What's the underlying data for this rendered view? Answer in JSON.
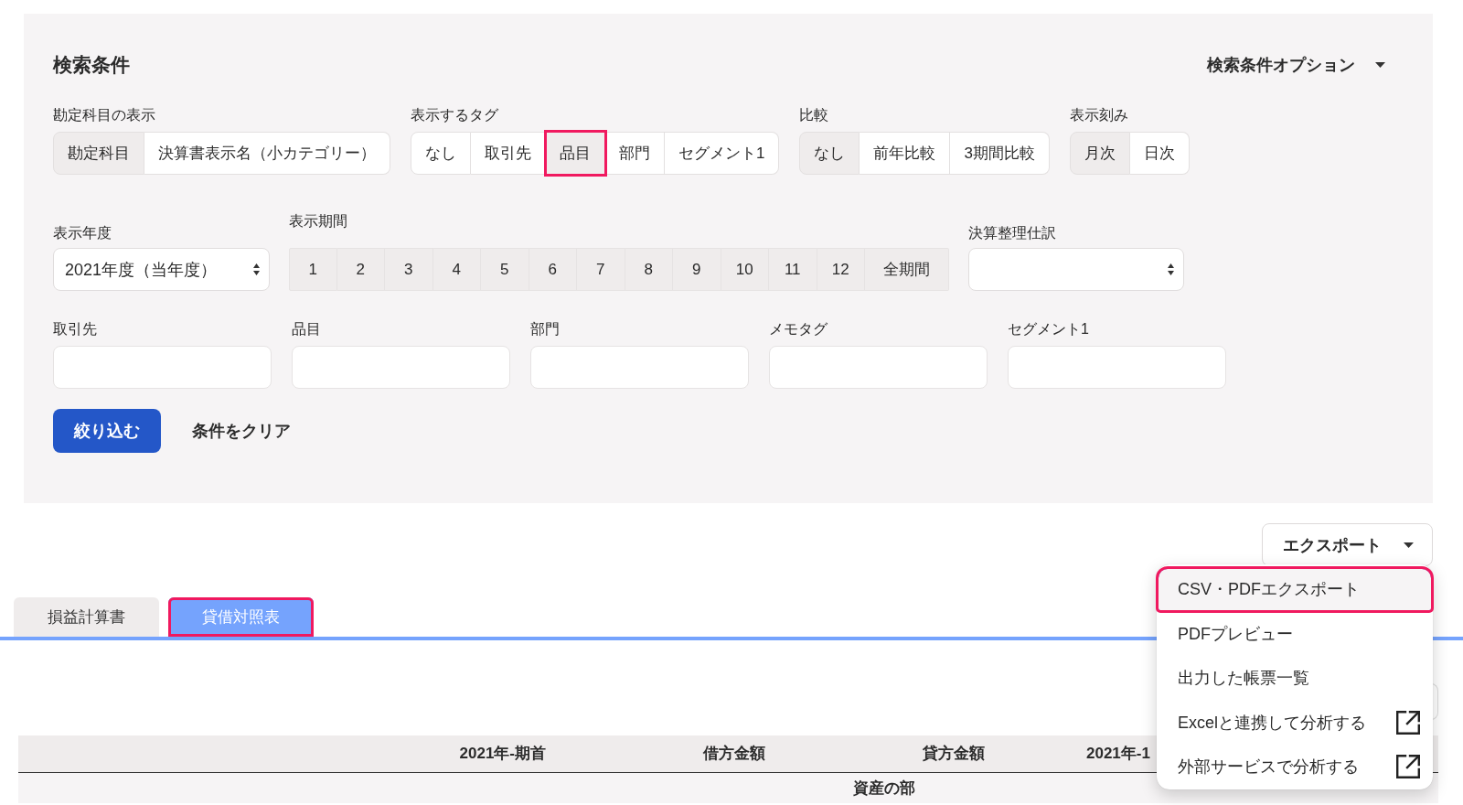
{
  "search_panel": {
    "title": "検索条件",
    "options_toggle": {
      "label": "検索条件オプション"
    },
    "account_display": {
      "label": "勘定科目の表示",
      "options": [
        {
          "label": "勘定科目",
          "selected": true
        },
        {
          "label": "決算書表示名（小カテゴリー）",
          "selected": false
        }
      ]
    },
    "display_tags": {
      "label": "表示するタグ",
      "options": [
        {
          "label": "なし",
          "selected": false,
          "highlighted": false
        },
        {
          "label": "取引先",
          "selected": false,
          "highlighted": false
        },
        {
          "label": "品目",
          "selected": true,
          "highlighted": true
        },
        {
          "label": "部門",
          "selected": false,
          "highlighted": false
        },
        {
          "label": "セグメント1",
          "selected": false,
          "highlighted": false
        }
      ]
    },
    "comparison": {
      "label": "比較",
      "options": [
        {
          "label": "なし",
          "selected": true
        },
        {
          "label": "前年比較",
          "selected": false
        },
        {
          "label": "3期間比較",
          "selected": false
        }
      ]
    },
    "granularity": {
      "label": "表示刻み",
      "options": [
        {
          "label": "月次",
          "selected": true
        },
        {
          "label": "日次",
          "selected": false
        }
      ]
    },
    "fiscal_year": {
      "label": "表示年度",
      "value": "2021年度（当年度）"
    },
    "period": {
      "label": "表示期間",
      "options": [
        {
          "label": "1",
          "selected": true
        },
        {
          "label": "2",
          "selected": true
        },
        {
          "label": "3",
          "selected": true
        },
        {
          "label": "4",
          "selected": true
        },
        {
          "label": "5",
          "selected": true
        },
        {
          "label": "6",
          "selected": true
        },
        {
          "label": "7",
          "selected": true
        },
        {
          "label": "8",
          "selected": true
        },
        {
          "label": "9",
          "selected": true
        },
        {
          "label": "10",
          "selected": true
        },
        {
          "label": "11",
          "selected": true
        },
        {
          "label": "12",
          "selected": true
        },
        {
          "label": "全期間",
          "selected": true
        }
      ]
    },
    "closing_entries": {
      "label": "決算整理仕訳"
    },
    "filters": [
      {
        "label": "取引先"
      },
      {
        "label": "品目"
      },
      {
        "label": "部門"
      },
      {
        "label": "メモタグ"
      },
      {
        "label": "セグメント1"
      }
    ],
    "apply_button": "絞り込む",
    "clear_button": "条件をクリア"
  },
  "export": {
    "label": "エクスポート",
    "expanded": true,
    "menu": [
      {
        "label": "CSV・PDFエクスポート",
        "focused": true,
        "highlighted": true,
        "external": false
      },
      {
        "label": "PDFプレビュー",
        "focused": false,
        "highlighted": false,
        "external": false
      },
      {
        "label": "出力した帳票一覧",
        "focused": false,
        "highlighted": false,
        "external": false
      },
      {
        "label": "Excelと連携して分析する",
        "focused": false,
        "highlighted": false,
        "external": true
      },
      {
        "label": "外部サービスで分析する",
        "focused": false,
        "highlighted": false,
        "external": true
      }
    ]
  },
  "tabs": [
    {
      "label": "損益計算書",
      "selected": false,
      "highlighted": false
    },
    {
      "label": "貸借対照表",
      "selected": true,
      "highlighted": true
    }
  ],
  "table": {
    "columns": [
      "2021年-期首",
      "借方金額",
      "貸方金額",
      "2021年-1"
    ],
    "rows": [
      {
        "kind": "section",
        "label": "資産の部"
      }
    ]
  }
}
